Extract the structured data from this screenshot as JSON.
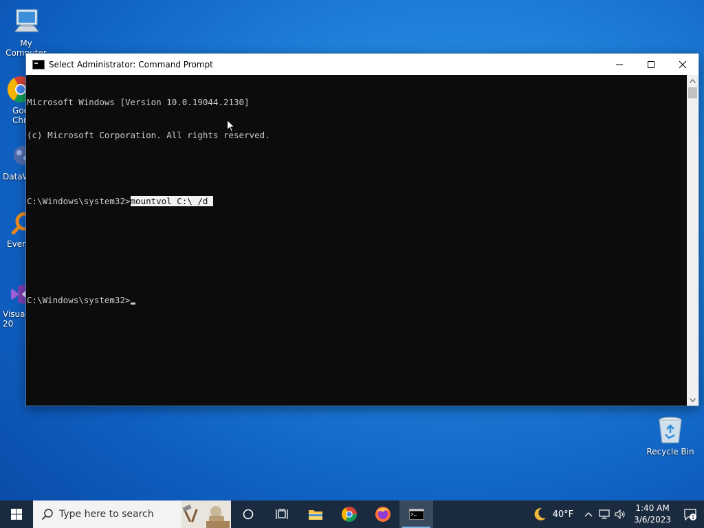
{
  "desktop": {
    "icons": [
      {
        "label": "My Computer"
      },
      {
        "label": "Goo\nChr"
      },
      {
        "label": "DataW"
      },
      {
        "label": "Every"
      },
      {
        "label": "Visual\n20"
      },
      {
        "label": "Recycle Bin"
      }
    ]
  },
  "window": {
    "title": "Select Administrator:  Command Prompt",
    "console_lines": [
      "Microsoft Windows [Version 10.0.19044.2130]",
      "(c) Microsoft Corporation. All rights reserved.",
      "",
      "C:\\Windows\\system32>",
      "",
      "",
      "C:\\Windows\\system32>"
    ],
    "selected_text": "mountvol C:\\ /d "
  },
  "taskbar": {
    "search_placeholder": "Type here to search",
    "weather_temp": "40°F",
    "time": "1:40 AM",
    "date": "3/6/2023",
    "notification_count": "1",
    "apps": [
      "cortana",
      "task-view",
      "file-explorer",
      "chrome",
      "firefox",
      "command-prompt"
    ]
  },
  "colors": {
    "console_bg": "#0c0c0c",
    "console_fg": "#cccccc",
    "taskbar_bg": "#1b2b3f",
    "desktop_accent": "#1e7fd8"
  }
}
